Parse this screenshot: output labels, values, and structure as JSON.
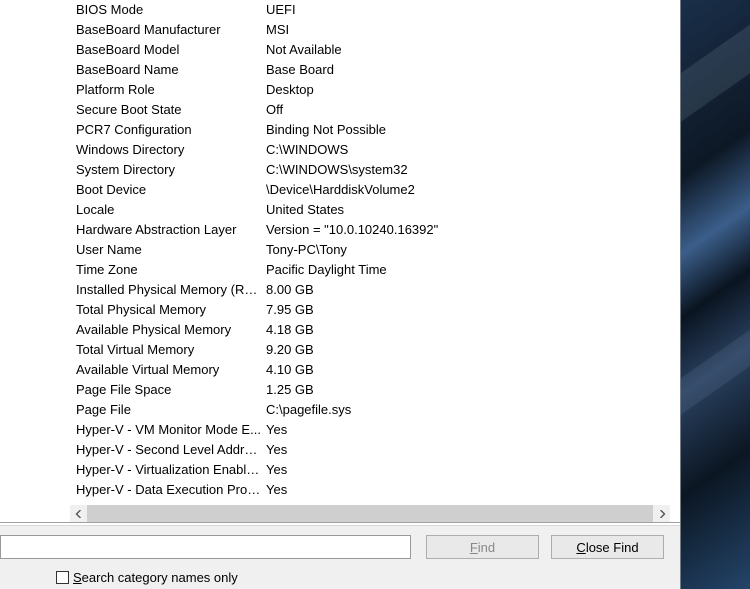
{
  "rows": [
    {
      "label": "BIOS Mode",
      "value": "UEFI"
    },
    {
      "label": "BaseBoard Manufacturer",
      "value": "MSI"
    },
    {
      "label": "BaseBoard Model",
      "value": "Not Available"
    },
    {
      "label": "BaseBoard Name",
      "value": "Base Board"
    },
    {
      "label": "Platform Role",
      "value": "Desktop"
    },
    {
      "label": "Secure Boot State",
      "value": "Off"
    },
    {
      "label": "PCR7 Configuration",
      "value": "Binding Not Possible"
    },
    {
      "label": "Windows Directory",
      "value": "C:\\WINDOWS"
    },
    {
      "label": "System Directory",
      "value": "C:\\WINDOWS\\system32"
    },
    {
      "label": "Boot Device",
      "value": "\\Device\\HarddiskVolume2"
    },
    {
      "label": "Locale",
      "value": "United States"
    },
    {
      "label": "Hardware Abstraction Layer",
      "value": "Version = \"10.0.10240.16392\""
    },
    {
      "label": "User Name",
      "value": "Tony-PC\\Tony"
    },
    {
      "label": "Time Zone",
      "value": "Pacific Daylight Time"
    },
    {
      "label": "Installed Physical Memory (RAM)",
      "value": "8.00 GB"
    },
    {
      "label": "Total Physical Memory",
      "value": "7.95 GB"
    },
    {
      "label": "Available Physical Memory",
      "value": "4.18 GB"
    },
    {
      "label": "Total Virtual Memory",
      "value": "9.20 GB"
    },
    {
      "label": "Available Virtual Memory",
      "value": "4.10 GB"
    },
    {
      "label": "Page File Space",
      "value": "1.25 GB"
    },
    {
      "label": "Page File",
      "value": "C:\\pagefile.sys"
    },
    {
      "label": "Hyper-V - VM Monitor Mode E...",
      "value": "Yes"
    },
    {
      "label": "Hyper-V - Second Level Addres...",
      "value": "Yes"
    },
    {
      "label": "Hyper-V - Virtualization Enable...",
      "value": "Yes"
    },
    {
      "label": "Hyper-V - Data Execution Prote...",
      "value": "Yes"
    }
  ],
  "find": {
    "input_value": "",
    "find_prefix": "F",
    "find_rest": "ind",
    "close_prefix": "C",
    "close_rest": "lose Find",
    "search_prefix": "S",
    "search_rest": "earch category names only",
    "searchChecked": false
  }
}
